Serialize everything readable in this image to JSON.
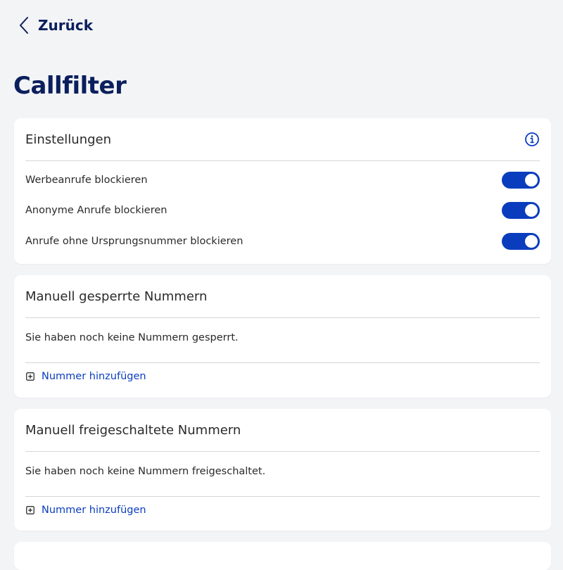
{
  "header": {
    "back_label": "Zurück",
    "title": "Callfilter"
  },
  "settings": {
    "title": "Einstellungen",
    "icon": "info-icon",
    "toggles": [
      {
        "label": "Werbeanrufe blockieren",
        "on": true
      },
      {
        "label": "Anonyme Anrufe blockieren",
        "on": true
      },
      {
        "label": "Anrufe ohne Ursprungsnummer blockieren",
        "on": true
      }
    ]
  },
  "blocked": {
    "title": "Manuell gesperrte Nummern",
    "empty_text": "Sie haben noch keine Nummern gesperrt.",
    "add_label": "Nummer hinzufügen"
  },
  "allowed": {
    "title": "Manuell freigeschaltete Nummern",
    "empty_text": "Sie haben noch keine Nummern freigeschaltet.",
    "add_label": "Nummer hinzufügen"
  },
  "colors": {
    "brand": "#0b1f5c",
    "accent": "#0a3dbe",
    "background": "#f3f4f6",
    "card": "#ffffff"
  }
}
